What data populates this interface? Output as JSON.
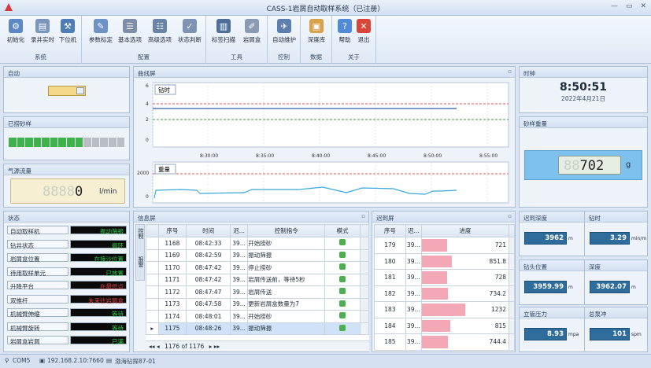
{
  "window": {
    "title": "CASS-1岩屑自动取样系统（已注册）",
    "controls": [
      "—",
      "▭",
      "✕"
    ]
  },
  "ribbon": {
    "groups": [
      {
        "label": "系统",
        "buttons": [
          {
            "label": "初始化",
            "icon": "init-icon",
            "color": "#5c88c4"
          },
          {
            "label": "录井实时",
            "icon": "realtime-icon",
            "color": "#7a96bc"
          },
          {
            "label": "下位机",
            "icon": "device-icon",
            "color": "#4f7db8"
          }
        ]
      },
      {
        "label": "配置",
        "buttons": [
          {
            "label": "参数标定",
            "icon": "calibrate-icon",
            "color": "#6d92c5"
          },
          {
            "label": "基本选项",
            "icon": "options-icon",
            "color": "#7d8ea8"
          },
          {
            "label": "高级选项",
            "icon": "advanced-icon",
            "color": "#6a84a8"
          },
          {
            "label": "状态判断",
            "icon": "status-icon",
            "color": "#7e93b3"
          }
        ]
      },
      {
        "label": "工具",
        "buttons": [
          {
            "label": "标签扫描",
            "icon": "scan-icon",
            "color": "#4e6f99"
          },
          {
            "label": "岩屑盒",
            "icon": "box-icon",
            "color": "#8a9ab2"
          }
        ]
      },
      {
        "label": "控制",
        "buttons": [
          {
            "label": "自动维护",
            "icon": "maintain-icon",
            "color": "#5d7fb0"
          }
        ]
      },
      {
        "label": "数据",
        "buttons": [
          {
            "label": "深度库",
            "icon": "database-icon",
            "color": "#d9a14a"
          }
        ]
      },
      {
        "label": "关于",
        "buttons": [
          {
            "label": "帮助",
            "icon": "help-icon",
            "color": "#4f8bd6"
          },
          {
            "label": "退出",
            "icon": "exit-icon",
            "color": "#d9453a"
          }
        ]
      }
    ]
  },
  "auto": {
    "title": "自动"
  },
  "sand": {
    "title": "已捞砂样",
    "total": 14,
    "filled": 9
  },
  "airflow": {
    "title": "气源流量",
    "digits": "0",
    "unit": "l/min"
  },
  "status": {
    "title": "状态",
    "items": [
      {
        "label": "自动取样机",
        "value": "振动筛振",
        "color": "#35d04b"
      },
      {
        "label": "钻井状态",
        "value": "循环",
        "color": "#35d04b"
      },
      {
        "label": "岩屑盒位置",
        "value": "在接沙位置",
        "color": "#35d04b"
      },
      {
        "label": "待用取样单元",
        "value": "已放置",
        "color": "#35d04b"
      },
      {
        "label": "升降平台",
        "value": "在最低点",
        "color": "#e23a3a"
      },
      {
        "label": "双推杆",
        "value": "未来往岩屑盒",
        "color": "#e23a3a"
      },
      {
        "label": "机械臂伸缩",
        "value": "等待",
        "color": "#35d04b"
      },
      {
        "label": "机械臂旋转",
        "value": "等待",
        "color": "#35d04b"
      },
      {
        "label": "岩屑盒岩屑",
        "value": "已满",
        "color": "#35d04b"
      }
    ]
  },
  "curve": {
    "title": "曲线屏",
    "plots": [
      {
        "label": "钻时",
        "yticks": [
          "6",
          "4",
          "2",
          "0"
        ]
      },
      {
        "label": "重量",
        "yticks": [
          "2000",
          "0"
        ]
      }
    ],
    "xticks": [
      "8:30:00",
      "8:35:00",
      "8:40:00",
      "8:45:00",
      "8:50:00",
      "8:55:00"
    ]
  },
  "clock": {
    "title": "时钟",
    "time": "8:50:51",
    "date": "2022年4月21日"
  },
  "weight": {
    "title": "砂样重量",
    "digits": "702",
    "unit": "g"
  },
  "info": {
    "title": "信息屏",
    "tabs": [
      "控制",
      "报警"
    ],
    "columns": [
      "序号",
      "时间",
      "迟...",
      "控制指令",
      "模式"
    ],
    "rows": [
      {
        "no": "1168",
        "time": "08:42:33",
        "lag": "39...",
        "cmd": "开始捞砂"
      },
      {
        "no": "1169",
        "time": "08:42:59",
        "lag": "39...",
        "cmd": "振动筛振"
      },
      {
        "no": "1170",
        "time": "08:47:42",
        "lag": "39...",
        "cmd": "停止捞砂"
      },
      {
        "no": "1171",
        "time": "08:47:42",
        "lag": "39...",
        "cmd": "岩屑传送前，等待5秒"
      },
      {
        "no": "1172",
        "time": "08:47:47",
        "lag": "39...",
        "cmd": "岩屑传送"
      },
      {
        "no": "1173",
        "time": "08:47:58",
        "lag": "39...",
        "cmd": "更新岩屑盒数量为7"
      },
      {
        "no": "1174",
        "time": "08:48:01",
        "lag": "39...",
        "cmd": "开始捞砂"
      },
      {
        "no": "1175",
        "time": "08:48:26",
        "lag": "39...",
        "cmd": "振动筛振"
      }
    ],
    "pager": "1176 of 1176"
  },
  "arrival": {
    "title": "迟到屏",
    "columns": [
      "序号",
      "迟...",
      "进度"
    ],
    "rows": [
      {
        "no": "179",
        "lag": "39...",
        "val": "721",
        "frac": 0.29
      },
      {
        "no": "180",
        "lag": "39...",
        "val": "851.8",
        "frac": 0.35
      },
      {
        "no": "181",
        "lag": "39...",
        "val": "728",
        "frac": 0.29
      },
      {
        "no": "182",
        "lag": "39...",
        "val": "734.2",
        "frac": 0.3
      },
      {
        "no": "183",
        "lag": "39...",
        "val": "1232",
        "frac": 0.5
      },
      {
        "no": "184",
        "lag": "39...",
        "val": "815",
        "frac": 0.33
      },
      {
        "no": "185",
        "lag": "39...",
        "val": "744.4",
        "frac": 0.3
      }
    ]
  },
  "metrics": [
    {
      "title": "迟到深度",
      "value": "3962",
      "unit": "m"
    },
    {
      "title": "钻时",
      "value": "3.29",
      "unit": "min/m"
    },
    {
      "title": "钻头位置",
      "value": "3959.99",
      "unit": "m"
    },
    {
      "title": "深度",
      "value": "3962.07",
      "unit": "m"
    },
    {
      "title": "立管压力",
      "value": "8.93",
      "unit": "mpa"
    },
    {
      "title": "总泵冲",
      "value": "101",
      "unit": "spm"
    }
  ],
  "statusbar": {
    "port": "COM5",
    "ip": "192.168.2.10:7660",
    "well": "渤海钻探87-01"
  }
}
